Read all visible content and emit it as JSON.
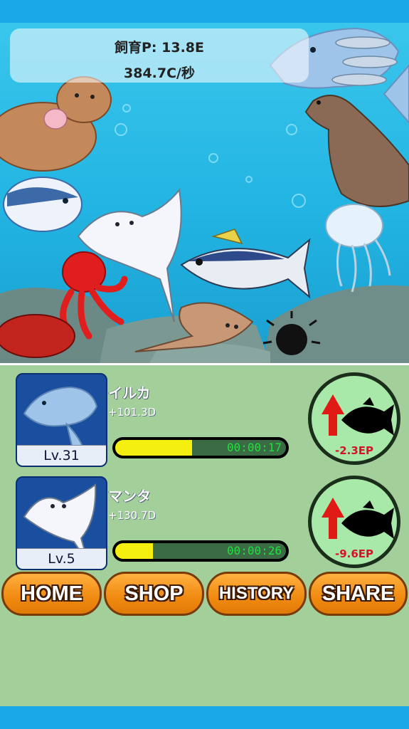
{
  "header": {
    "breeding_points": "飼育P:  13.8E",
    "rate": "384.7C/秒"
  },
  "animals": [
    {
      "name": "イルカ",
      "bonus": "+101.3D",
      "level": "Lv.31",
      "timer": "00:00:17",
      "progress": 0.45,
      "upgrade_cost": "-2.3EP",
      "icon": "dolphin-icon"
    },
    {
      "name": "マンタ",
      "bonus": "+130.7D",
      "level": "Lv.5",
      "timer": "00:00:26",
      "progress": 0.22,
      "upgrade_cost": "-9.6EP",
      "icon": "manta-icon"
    }
  ],
  "nav": {
    "home": "HOME",
    "shop": "SHOP",
    "history": "HISTORY",
    "share": "SHARE"
  },
  "colors": {
    "bar_fill": "#f5ef10",
    "timer_text": "#1fe03c",
    "cost_text": "#d8102a",
    "nav_button": "#f08a10",
    "panel_bg": "#a2cf9a",
    "top_bar": "#1aa8e8"
  }
}
